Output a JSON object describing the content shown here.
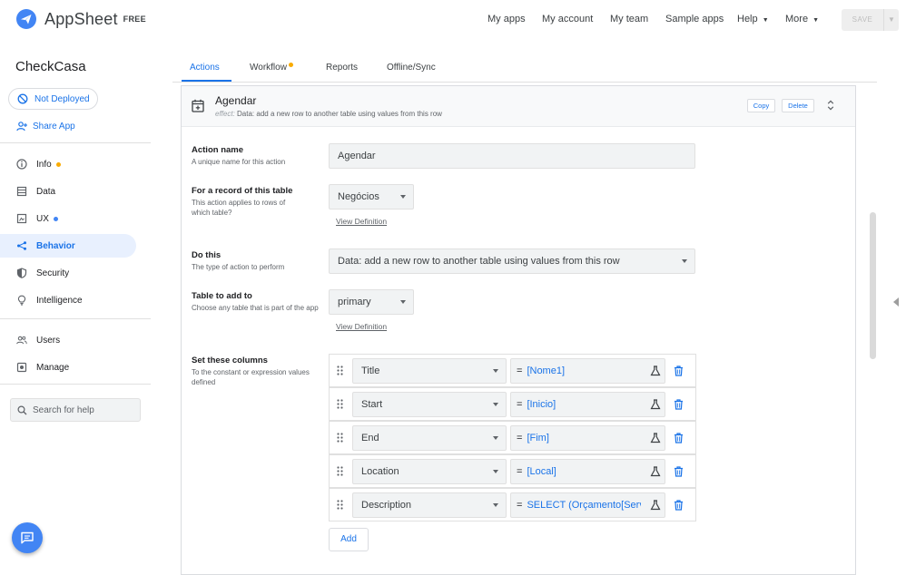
{
  "brand": {
    "name": "AppSheet",
    "tier": "FREE"
  },
  "topnav": {
    "my_apps": "My apps",
    "my_account": "My account",
    "my_team": "My team",
    "sample_apps": "Sample apps",
    "help": "Help",
    "more": "More",
    "save": "SAVE"
  },
  "sidebar": {
    "app_name": "CheckCasa",
    "deploy_status": "Not Deployed",
    "share": "Share App",
    "items": [
      {
        "label": "Info",
        "icon": "info-icon",
        "dot": "#f9ab00"
      },
      {
        "label": "Data",
        "icon": "data-icon"
      },
      {
        "label": "UX",
        "icon": "ux-icon",
        "dot": "#4285f4"
      },
      {
        "label": "Behavior",
        "icon": "behavior-icon"
      },
      {
        "label": "Security",
        "icon": "shield-icon"
      },
      {
        "label": "Intelligence",
        "icon": "bulb-icon"
      },
      {
        "label": "Users",
        "icon": "users-icon"
      },
      {
        "label": "Manage",
        "icon": "manage-icon"
      }
    ],
    "search_placeholder": "Search for help"
  },
  "tabs": [
    {
      "label": "Actions",
      "active": true
    },
    {
      "label": "Workflow",
      "dot": "#f9ab00"
    },
    {
      "label": "Reports"
    },
    {
      "label": "Offline/Sync"
    }
  ],
  "action": {
    "title": "Agendar",
    "effect_label": "effect:",
    "effect_text": "Data: add a new row to another table using values from this row",
    "copy": "Copy",
    "delete": "Delete",
    "name_label": "Action name",
    "name_sub": "A unique name for this action",
    "name_value": "Agendar",
    "record_label": "For a record of this table",
    "record_sub": "This action applies to rows of which table?",
    "record_value": "Negócios",
    "view_definition": "View Definition",
    "do_label": "Do this",
    "do_sub": "The type of action to perform",
    "do_value": "Data: add a new row to another table using values from this row",
    "table_label": "Table to add to",
    "table_sub": "Choose any table that is part of the app",
    "table_value": "primary",
    "set_label": "Set these columns",
    "set_sub": "To the constant or expression values defined",
    "columns": [
      {
        "column": "Title",
        "eq": "=",
        "expr": "[Nome1]"
      },
      {
        "column": "Start",
        "eq": "=",
        "expr": "[Inicio]"
      },
      {
        "column": "End",
        "eq": "=",
        "expr": "[Fim]"
      },
      {
        "column": "Location",
        "eq": "=",
        "expr": "[Local]"
      },
      {
        "column": "Description",
        "eq": "=",
        "expr": "SELECT (Orçamento[Servm"
      }
    ],
    "add": "Add"
  },
  "colors": {
    "accent": "#1a73e8",
    "active_bg": "#e8f0fe",
    "chat": "#4285f4"
  }
}
